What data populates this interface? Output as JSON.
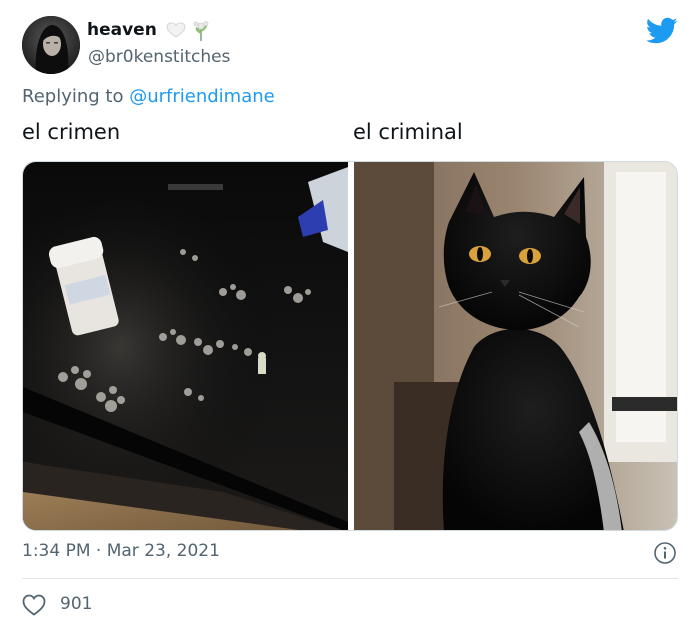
{
  "author": {
    "display_name": "heaven",
    "handle": "@br0kenstitches",
    "badges": [
      "white-heart-icon",
      "lily-sprig-icon"
    ]
  },
  "reply": {
    "prefix": "Replying to",
    "mention": "@urfriendimane"
  },
  "captions": {
    "left": "el crimen",
    "right": "el criminal"
  },
  "media": {
    "photos": [
      "paw prints on dark table with pill bottle",
      "black cat with amber eyes"
    ]
  },
  "meta": {
    "timestamp": "1:34 PM · Mar 23, 2021"
  },
  "engagement": {
    "likes": "901"
  },
  "colors": {
    "brand": "#1d9bf0",
    "muted": "#536471",
    "text": "#0f1419",
    "divider": "#dfe5e9"
  },
  "icons": {
    "brand": "twitter-bird-icon",
    "info": "info-icon",
    "like": "heart-outline-icon"
  }
}
